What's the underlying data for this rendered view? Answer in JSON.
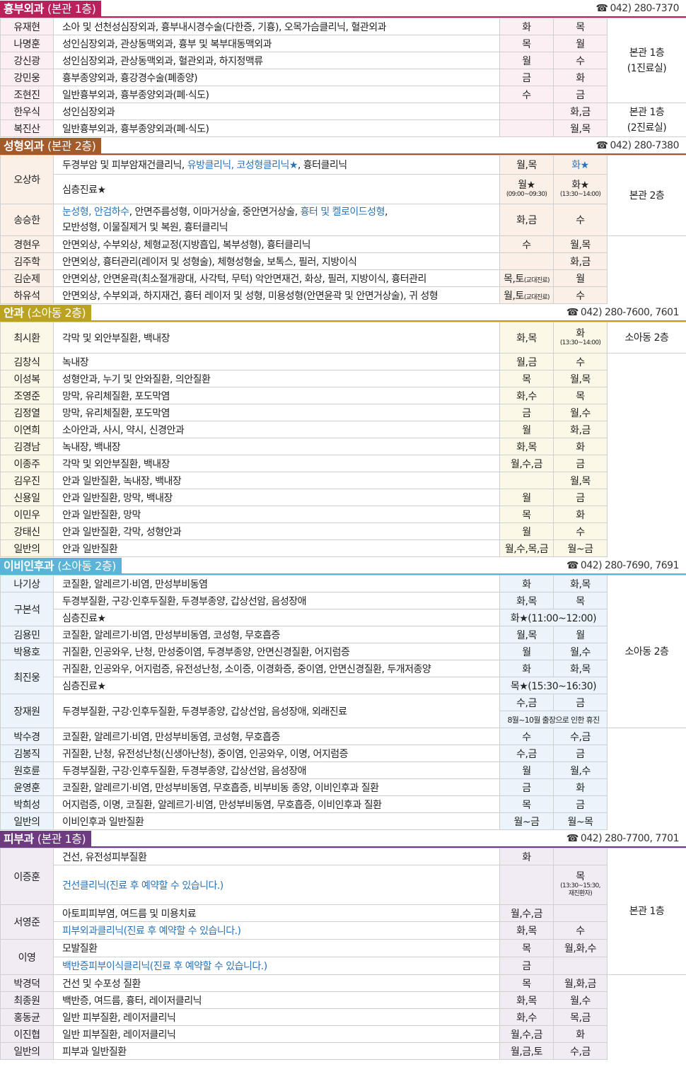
{
  "colors": {
    "chest": {
      "main": "#b8215c",
      "tint": "#fbeff3"
    },
    "plastic": {
      "main": "#a55a2a",
      "tint": "#faf0e8"
    },
    "eye": {
      "main": "#bba321",
      "tint": "#fcf8e7"
    },
    "ent": {
      "main": "#5ab4d7",
      "tint": "#eaf4fa"
    },
    "derm": {
      "main": "#6e3b81",
      "tint": "#f1ebf4"
    }
  },
  "sections": {
    "chest": {
      "title": "흉부외과",
      "sub": "(본관 1층)",
      "phone": "042) 280-7370",
      "loc1": "본관 1층\n(1진료실)",
      "loc2": "본관 1층\n(2진료실)",
      "rows": [
        {
          "name": "유재현",
          "desc": "소아 및 선천성심장외과, 흉부내시경수술(다한증, 기흉), 오목가슴클리닉, 혈관외과",
          "d1": "화",
          "d2": "목"
        },
        {
          "name": "나명훈",
          "desc": "성인심장외과, 관상동맥외과, 흉부 및 복부대동맥외과",
          "d1": "목",
          "d2": "월"
        },
        {
          "name": "강신광",
          "desc": "성인심장외과, 관상동맥외과, 혈관외과, 하지정맥류",
          "d1": "월",
          "d2": "수"
        },
        {
          "name": "강민웅",
          "desc": "흉부종양외과, 흉강경수술(폐종양)",
          "d1": "금",
          "d2": "화"
        },
        {
          "name": "조현진",
          "desc": "일반흉부외과, 흉부종양외과(폐·식도)",
          "d1": "수",
          "d2": "금"
        },
        {
          "name": "한우식",
          "desc": "성인심장외과",
          "d1": "",
          "d2": "화,금"
        },
        {
          "name": "복진산",
          "desc": "일반흉부외과, 흉부종양외과(폐·식도)",
          "d1": "",
          "d2": "월,목"
        }
      ]
    },
    "plastic": {
      "title": "성형외과",
      "sub": "(본관 2층)",
      "phone": "042) 280-7380",
      "loc": "본관 2층",
      "r1": {
        "name": "오상하",
        "desc_a": "두경부암 및 피부암재건클리닉, ",
        "desc_b": "유방클리닉, 코성형클리닉★",
        "desc_c": ", 흉터클리닉",
        "d1": "월,목",
        "d2": "화★"
      },
      "r1b": {
        "desc": "심층진료★",
        "d1": "월★",
        "d1note": "(09:00~09:30)",
        "d2": "화★",
        "d2note": "(13:30~14:00)"
      },
      "r2": {
        "name": "송승한",
        "desc_a": "눈성형, 안검하수",
        "desc_b": ", 안면주름성형, 이마거상술, 중안면거상술, ",
        "desc_c": "흉터 및 켈로이드성형",
        "desc_d": ",",
        "desc_e": "모반성형, 이물질제거 및 복원, 흉터클리닉",
        "d1": "화,금",
        "d2": "수"
      },
      "rows": [
        {
          "name": "경현우",
          "desc": "안면외상, 수부외상, 체형교정(지방흡입, 복부성형), 흉터클리닉",
          "d1": "수",
          "d1n": "",
          "d2": "월,목"
        },
        {
          "name": "김주학",
          "desc": "안면외상, 흉터관리(레이저 및 성형술), 체형성형술, 보톡스, 필러, 지방이식",
          "d1": "",
          "d1n": "",
          "d2": "화,금"
        },
        {
          "name": "김순제",
          "desc": "안면외상, 안면윤곽(최소절개광대, 사각턱, 무턱) 악안면재건, 화상, 필러, 지방이식, 흉터관리",
          "d1": "목,토",
          "d1n": "(교대진료)",
          "d2": "월"
        },
        {
          "name": "하유석",
          "desc": "안면외상, 수부외과, 하지재건, 흉터 레이저 및 성형, 미용성형(안면윤곽 및 안면거상술), 귀 성형",
          "d1": "월,토",
          "d1n": "(교대진료)",
          "d2": "수"
        }
      ]
    },
    "eye": {
      "title": "안과",
      "sub": "(소아동 2층)",
      "phone": "042) 280-7600, 7601",
      "loc": "소아동 2층",
      "r1": {
        "name": "최시환",
        "desc": "각막 및 외안부질환, 백내장",
        "d1": "화,목",
        "d2": "화",
        "d2note": "(13:30~14:00)"
      },
      "rows": [
        {
          "name": "김창식",
          "desc": "녹내장",
          "d1": "월,금",
          "d2": "수"
        },
        {
          "name": "이성복",
          "desc": "성형안과, 누기 및 안와질환, 의안질환",
          "d1": "목",
          "d2": "월,목"
        },
        {
          "name": "조영준",
          "desc": "망막, 유리체질환, 포도막염",
          "d1": "화,수",
          "d2": "목"
        },
        {
          "name": "김정열",
          "desc": "망막, 유리체질환, 포도막염",
          "d1": "금",
          "d2": "월,수"
        },
        {
          "name": "이연희",
          "desc": "소아안과, 사시, 약시, 신경안과",
          "d1": "월",
          "d2": "화,금"
        },
        {
          "name": "김경남",
          "desc": "녹내장, 백내장",
          "d1": "화,목",
          "d2": "화"
        },
        {
          "name": "이종주",
          "desc": "각막 및 외안부질환, 백내장",
          "d1": "월,수,금",
          "d2": "금"
        },
        {
          "name": "김우진",
          "desc": "안과 일반질환, 녹내장, 백내장",
          "d1": "",
          "d2": "월,목"
        },
        {
          "name": "신용일",
          "desc": "안과 일반질환, 망막, 백내장",
          "d1": "월",
          "d2": "금"
        },
        {
          "name": "이민우",
          "desc": "안과 일반질환, 망막",
          "d1": "목",
          "d2": "화"
        },
        {
          "name": "강태신",
          "desc": "안과 일반질환, 각막, 성형안과",
          "d1": "월",
          "d2": "수"
        },
        {
          "name": "일반의",
          "desc": "안과 일반질환",
          "d1": "월,수,목,금",
          "d2": "월~금"
        }
      ]
    },
    "ent": {
      "title": "이비인후과",
      "sub": "(소아동 2층)",
      "phone": "042) 280-7690, 7691",
      "loc": "소아동 2층",
      "r0": {
        "name": "나기상",
        "desc": "코질환, 알레르기·비염, 만성부비동염",
        "d1": "화",
        "d2": "화,목"
      },
      "r1": {
        "name": "구본석",
        "desc": "두경부질환, 구강·인후두질환, 두경부종양, 갑상선암, 음성장애",
        "d1": "화,목",
        "d2": "목"
      },
      "r1b": {
        "desc": "심층진료★",
        "merged": "화★(11:00~12:00)"
      },
      "r2": {
        "name": "김용민",
        "desc": "코질환, 알레르기·비염, 만성부비동염, 코성형, 무호흡증",
        "d1": "월,목",
        "d2": "월"
      },
      "r3": {
        "name": "박용호",
        "desc": "귀질환, 인공와우, 난청, 만성중이염, 두경부종양, 안면신경질환, 어지럼증",
        "d1": "월",
        "d2": "월,수"
      },
      "r4": {
        "name": "최진웅",
        "desc": "귀질환, 인공와우, 어지럼증, 유전성난청, 소이증, 이경화증, 중이염, 안면신경질환, 두개저종양",
        "d1": "화",
        "d2": "화,목"
      },
      "r4b": {
        "desc": "심층진료★",
        "merged": "목★(15:30~16:30)"
      },
      "r5": {
        "name": "장재원",
        "desc": "두경부질환, 구강·인후두질환, 두경부종양, 갑상선암, 음성장애, 외래진료",
        "d1": "수,금",
        "d2": "금",
        "note": "8월~10월 출장으로 인한 휴진"
      },
      "rows": [
        {
          "name": "박수경",
          "desc": "코질환, 알레르기·비염, 만성부비동염, 코성형, 무호흡증",
          "d1": "수",
          "d2": "수,금"
        },
        {
          "name": "김봉직",
          "desc": "귀질환, 난청, 유전성난청(신생아난청), 중이염, 인공와우, 이명, 어지럼증",
          "d1": "수,금",
          "d2": "금"
        },
        {
          "name": "원호륜",
          "desc": "두경부질환, 구강·인후두질환, 두경부종양, 갑상선암, 음성장애",
          "d1": "월",
          "d2": "월,수"
        },
        {
          "name": "윤영훈",
          "desc": "코질환, 알레르기·비염, 만성부비동염, 무호흡증, 비부비동 종양, 이비인후과 질환",
          "d1": "금",
          "d2": "화"
        },
        {
          "name": "박희성",
          "desc": "어지럼증, 이명, 코질환, 알레르기·비염, 만성부비동염, 무호흡증, 이비인후과 질환",
          "d1": "목",
          "d2": "금"
        },
        {
          "name": "일반의",
          "desc": "이비인후과 일반질환",
          "d1": "월~금",
          "d2": "월~목"
        }
      ]
    },
    "derm": {
      "title": "피부과",
      "sub": "(본관 1층)",
      "phone": "042) 280-7700, 7701",
      "loc": "본관 1층",
      "r1": {
        "name": "이증훈",
        "desc": "건선, 유전성피부질환",
        "d1": "화",
        "d2": ""
      },
      "r1b": {
        "desc": "건선클리닉(진료 후 예약할 수 있습니다.)",
        "d1": "",
        "d2": "목",
        "d2note": "(13:30~15:30,\n재진환자)"
      },
      "r2": {
        "name": "서영준",
        "desc": "아토피피부염, 여드름 및 미용치료",
        "d1": "월,수,금",
        "d2": ""
      },
      "r2b": {
        "desc": "피부외과클리닉(진료 후 예약할 수 있습니다.)",
        "d1": "화,목",
        "d2": "수"
      },
      "r3": {
        "name": "이영",
        "desc": "모발질환",
        "d1": "목",
        "d2": "월,화,수"
      },
      "r3b": {
        "desc": "백반증피부이식클리닉(진료 후 예약할 수 있습니다.)",
        "d1": "금",
        "d2": ""
      },
      "rows": [
        {
          "name": "박경덕",
          "desc": "건선 및 수포성 질환",
          "d1": "목",
          "d2": "월,화,금"
        },
        {
          "name": "최종원",
          "desc": "백반증, 여드름, 흉터, 레이저클리닉",
          "d1": "화,목",
          "d2": "월,수"
        },
        {
          "name": "홍동균",
          "desc": "일반 피부질환, 레이저클리닉",
          "d1": "화,수",
          "d2": "목,금"
        },
        {
          "name": "이진협",
          "desc": "일반 피부질환, 레이저클리닉",
          "d1": "월,수,금",
          "d2": "화"
        },
        {
          "name": "일반의",
          "desc": "피부과 일반질환",
          "d1": "월,금,토",
          "d2": "수,금"
        }
      ]
    }
  },
  "icons": {
    "phone": "phone-icon"
  }
}
